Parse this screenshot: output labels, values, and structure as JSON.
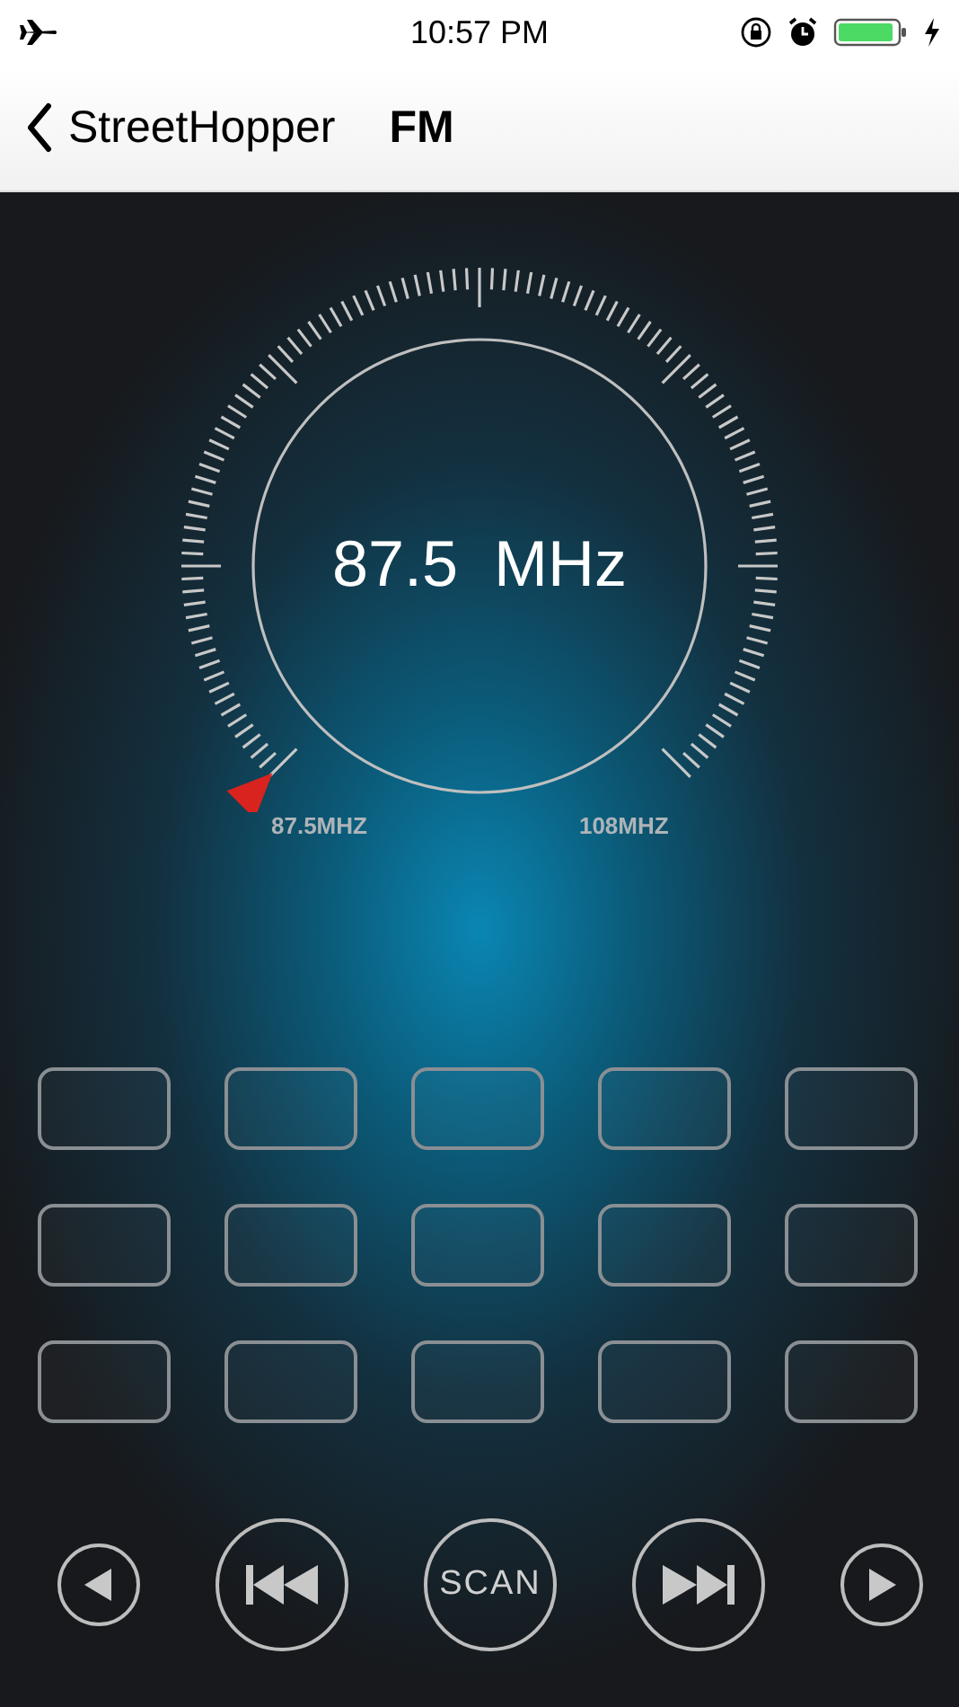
{
  "status_bar": {
    "time": "10:57 PM"
  },
  "nav": {
    "back_label": "StreetHopper",
    "title": "FM"
  },
  "tuner": {
    "frequency": "87.5",
    "unit": "MHz",
    "min_label": "87.5MHZ",
    "max_label": "108MHZ"
  },
  "presets": [
    {
      "kind": "empty"
    },
    {
      "kind": "empty"
    },
    {
      "kind": "empty"
    },
    {
      "kind": "empty"
    },
    {
      "kind": "empty"
    },
    {
      "kind": "empty"
    },
    {
      "kind": "empty"
    },
    {
      "kind": "empty"
    },
    {
      "kind": "empty"
    },
    {
      "kind": "empty"
    },
    {
      "kind": "empty"
    },
    {
      "kind": "empty"
    },
    {
      "kind": "empty"
    },
    {
      "kind": "empty"
    },
    {
      "kind": "empty"
    }
  ],
  "controls": [
    {
      "kind": "prev"
    },
    {
      "kind": "seek-back"
    },
    {
      "kind": "scan",
      "label": "SCAN"
    },
    {
      "kind": "seek-forward"
    },
    {
      "kind": "next"
    }
  ]
}
